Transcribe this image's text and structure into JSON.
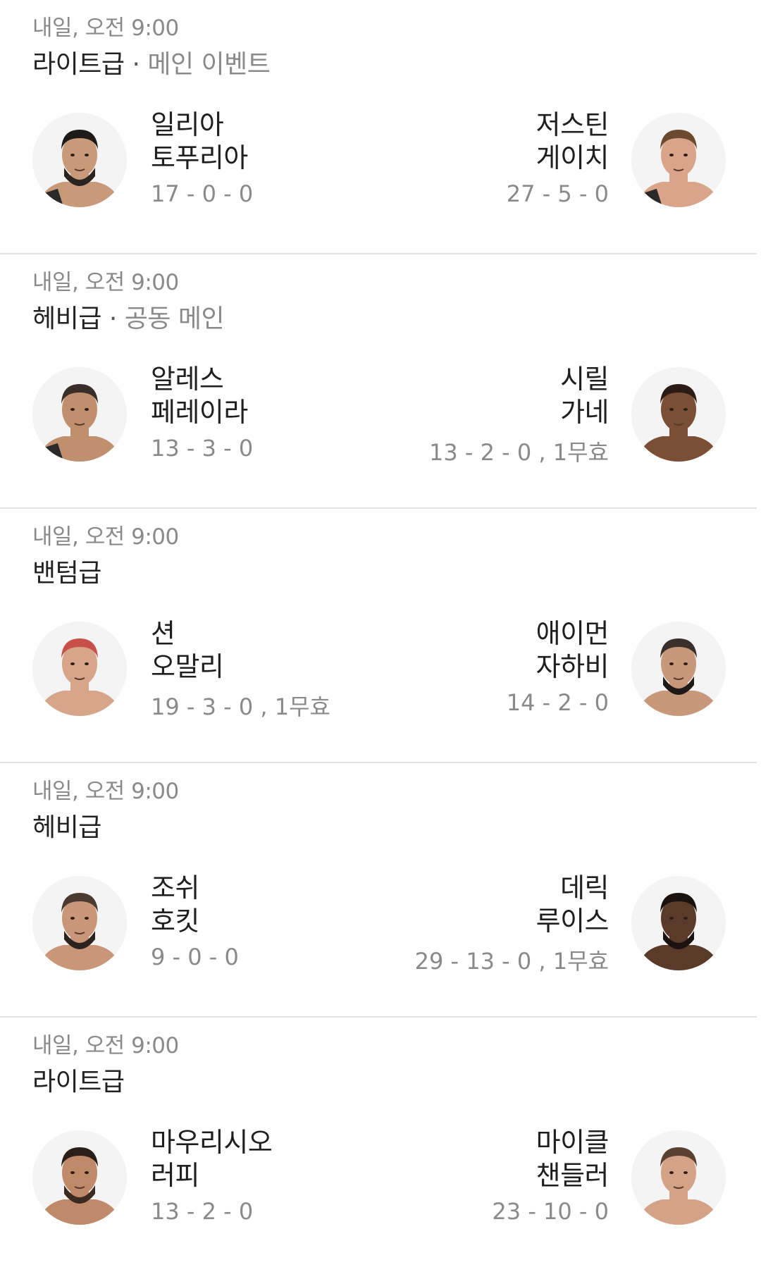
{
  "fights": [
    {
      "time": "내일, 오전 9:00",
      "division": "라이트급",
      "separator": "·",
      "tag": "메인 이벤트",
      "left": {
        "first": "일리아",
        "last": "토푸리아",
        "record": "17 - 0 - 0",
        "skin": "#c89a7a",
        "hair": "#1d1a18",
        "beard": "#2a2420",
        "belt": "#2a2a2a"
      },
      "right": {
        "first": "저스틴",
        "last": "게이치",
        "record": "27 - 5 - 0",
        "skin": "#d9a489",
        "hair": "#6b4a30",
        "beard": "",
        "belt": "#2a2a2a"
      }
    },
    {
      "time": "내일, 오전 9:00",
      "division": "헤비급",
      "separator": "·",
      "tag": "공동 메인",
      "left": {
        "first": "알레스",
        "last": "페레이라",
        "record": "13 - 3 - 0",
        "skin": "#c0906e",
        "hair": "#3a2e28",
        "beard": "",
        "belt": "#2a2a2a"
      },
      "right": {
        "first": "시릴",
        "last": "가네",
        "record": "13 - 2 - 0 , 1무효",
        "skin": "#7a4f35",
        "hair": "#2a1c14",
        "beard": "",
        "belt": ""
      }
    },
    {
      "time": "내일, 오전 9:00",
      "division": "밴텀급",
      "separator": "",
      "tag": "",
      "left": {
        "first": "션",
        "last": "오말리",
        "record": "19 - 3 - 0 , 1무효",
        "skin": "#d6a58a",
        "hair": "#c9504a",
        "beard": "",
        "belt": ""
      },
      "right": {
        "first": "애이먼",
        "last": "자하비",
        "record": "14 - 2 - 0",
        "skin": "#c8987a",
        "hair": "#3a2f2a",
        "beard": "#1e1a18",
        "belt": ""
      }
    },
    {
      "time": "내일, 오전 9:00",
      "division": "헤비급",
      "separator": "",
      "tag": "",
      "left": {
        "first": "조쉬",
        "last": "호킷",
        "record": "9 - 0 - 0",
        "skin": "#c99679",
        "hair": "#4a3a30",
        "beard": "#2a221e",
        "belt": ""
      },
      "right": {
        "first": "데릭",
        "last": "루이스",
        "record": "29 - 13 - 0 , 1무효",
        "skin": "#5a3a28",
        "hair": "#1a120e",
        "beard": "#1a120e",
        "belt": ""
      }
    },
    {
      "time": "내일, 오전 9:00",
      "division": "라이트급",
      "separator": "",
      "tag": "",
      "left": {
        "first": "마우리시오",
        "last": "러피",
        "record": "13 - 2 - 0",
        "skin": "#c08a6a",
        "hair": "#2a1e18",
        "beard": "#3a2a20",
        "belt": ""
      },
      "right": {
        "first": "마이클",
        "last": "챈들러",
        "record": "23 - 10 - 0",
        "skin": "#d4a286",
        "hair": "#5a4030",
        "beard": "",
        "belt": ""
      }
    }
  ]
}
